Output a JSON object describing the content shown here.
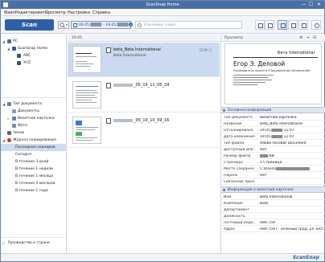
{
  "window": {
    "title": "ScanSnap Home",
    "minimize": "—",
    "maximize": "☐",
    "close": "✕"
  },
  "menu": [
    "Файл",
    "Редактировать",
    "Просмотр",
    "Настройка",
    "Справка"
  ],
  "toolbar": {
    "scan_label": "Scan",
    "date_range": "06.05.▒▒▒▒ – 19.05.▒▒▒▒",
    "keyword_placeholder": "Ключевые слова"
  },
  "tree": {
    "pc_label": "PC",
    "scansnap_home_label": "ScanSnap Home",
    "folders": [
      "ABC",
      "XYZ"
    ],
    "doc_types_label": "Тип документа",
    "doc_types": [
      "Документы",
      "Визитная карточка",
      "Фото"
    ],
    "receipt_label": "Чеков",
    "journal_label": "Журнал сканирования",
    "journal_items": [
      "Последние сканиров",
      "Сегодня",
      "В течение 3 дней",
      "В течение 1 недели",
      "В течение 1 месяца",
      "В течение 3 месяцев",
      "В течение 1 года"
    ],
    "guide_label": "Руководство к стране"
  },
  "list": {
    "header_date": "19.05.",
    "items": [
      {
        "name": "beta_Beta International",
        "subtitle": "Beta International",
        "selected": true
      },
      {
        "name_suffix": "_05_19_11_05_24",
        "subtitle": "",
        "selected": false
      },
      {
        "name_suffix": "_05_19_10_59_16",
        "subtitle": "",
        "selected": false
      }
    ]
  },
  "preview": {
    "header": "Просмотр",
    "card_org": "Бета International",
    "card_name": "Егор Э. Деловой",
    "card_position": "Руководитель проекта «Продвижение обновлений»"
  },
  "basic_info": {
    "header": "Основная информация",
    "rows": [
      {
        "k": "Тип документа",
        "v": "Визитная карточка"
      },
      {
        "k": "Название",
        "v": "beta_Beta International"
      },
      {
        "k": "Отсканировано",
        "v": "19.05.▒▒▒▒ 11:07"
      },
      {
        "k": "Дата изменения",
        "v": "19.05.▒▒▒▒ 11:07"
      },
      {
        "k": "Тип файла",
        "v": "Adobe Acrobat Document"
      },
      {
        "k": "Доступный для…",
        "v": "Нет"
      },
      {
        "k": "Размер файла",
        "v": "▒▒▒ KB"
      },
      {
        "k": "Страницы",
        "v": "1 Страница"
      },
      {
        "k": "Место сохранен…",
        "v": "C:\\Users\\▒▒▒▒▒▒▒▒▒▒▒▒"
      },
      {
        "k": "Пароль",
        "v": "Нет"
      },
      {
        "k": "Связанное прил…",
        "v": ""
      }
    ]
  },
  "card_info": {
    "header": "Информация о визитной карточке",
    "rows": [
      {
        "k": "Имя",
        "v": "Beta International"
      },
      {
        "k": "Компания",
        "v": "beta"
      },
      {
        "k": "Департамент",
        "v": ""
      },
      {
        "k": "Должность",
        "v": ""
      },
      {
        "k": "Почтовый инде…",
        "v": "090-759"
      },
      {
        "k": "Адрес",
        "v": "090-759 г. Зелёный град, ул. Бета"
      }
    ]
  },
  "status": {
    "brand": "ScanSnap"
  },
  "colors": {
    "accent": "#2f5fa6",
    "selection": "#cbdaf0",
    "titlebar": "#4a6fa5"
  }
}
